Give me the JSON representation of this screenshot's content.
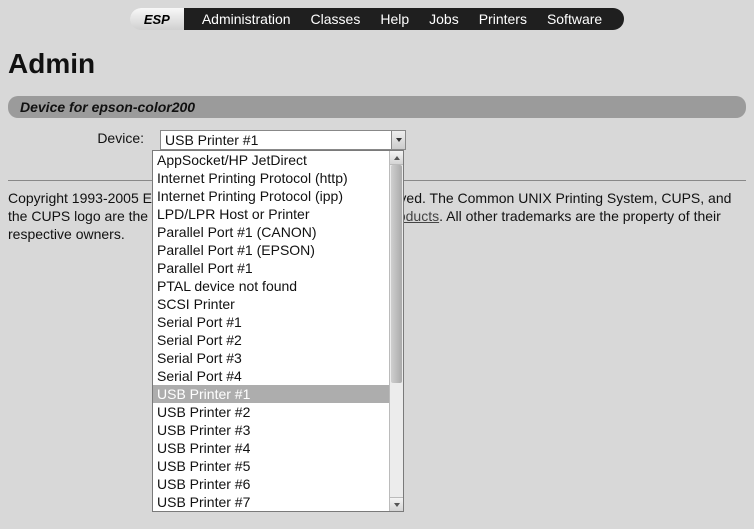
{
  "nav": {
    "brand": "ESP",
    "items": [
      "Administration",
      "Classes",
      "Help",
      "Jobs",
      "Printers",
      "Software"
    ]
  },
  "page_title": "Admin",
  "section_label": "Device for epson-color200",
  "form": {
    "label": "Device:",
    "selected": "USB Printer #1",
    "options": [
      "AppSocket/HP JetDirect",
      "Internet Printing Protocol (http)",
      "Internet Printing Protocol (ipp)",
      "LPD/LPR Host or Printer",
      "Parallel Port #1 (CANON)",
      "Parallel Port #1 (EPSON)",
      "Parallel Port #1",
      "PTAL device not found",
      "SCSI Printer",
      "Serial Port #1",
      "Serial Port #2",
      "Serial Port #3",
      "Serial Port #4",
      "USB Printer #1",
      "USB Printer #2",
      "USB Printer #3",
      "USB Printer #4",
      "USB Printer #5",
      "USB Printer #6",
      "USB Printer #7"
    ],
    "selected_index": 13
  },
  "footer": {
    "pre": "Copyright 1993-2005 Easy Software Products, All Rights Reserved. The Common UNIX Printing System, CUPS, and the CUPS logo are the trademark property of ",
    "link": "Easy Software Products",
    "post": ". All other trademarks are the property of their respective owners."
  }
}
